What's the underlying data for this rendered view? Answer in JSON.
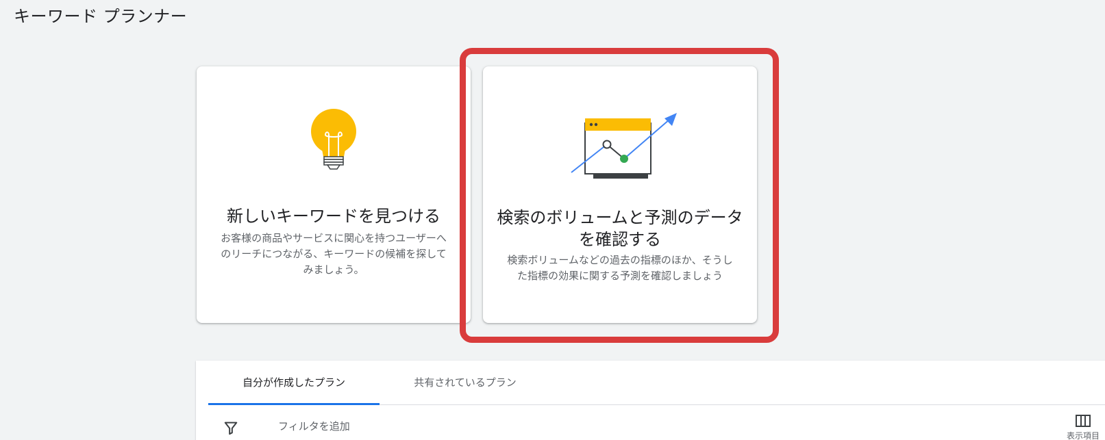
{
  "header": {
    "title": "キーワード プランナー"
  },
  "cards": {
    "discover": {
      "heading": "新しいキーワードを見つける",
      "description": "お客様の商品やサービスに関心を持つユーザーへのリーチにつながる、キーワードの候補を探してみましょう。",
      "icon": "lightbulb-icon",
      "icon_color": "#fbbc04"
    },
    "forecast": {
      "heading": "検索のボリュームと予測のデータを確認する",
      "description": "検索ボリュームなどの過去の指標のほか、そうした指標の効果に関する予測を確認しましょう",
      "icon": "trend-chart-icon",
      "highlighted": true,
      "highlight_color": "#d93c3c"
    }
  },
  "plans": {
    "tabs": [
      {
        "label": "自分が作成したプラン",
        "active": true
      },
      {
        "label": "共有されているプラン",
        "active": false
      }
    ],
    "filter_label": "フィルタを追加",
    "columns_label": "表示項目"
  },
  "colors": {
    "accent": "#1a73e8",
    "background": "#f1f3f4",
    "highlight": "#d93c3c"
  }
}
